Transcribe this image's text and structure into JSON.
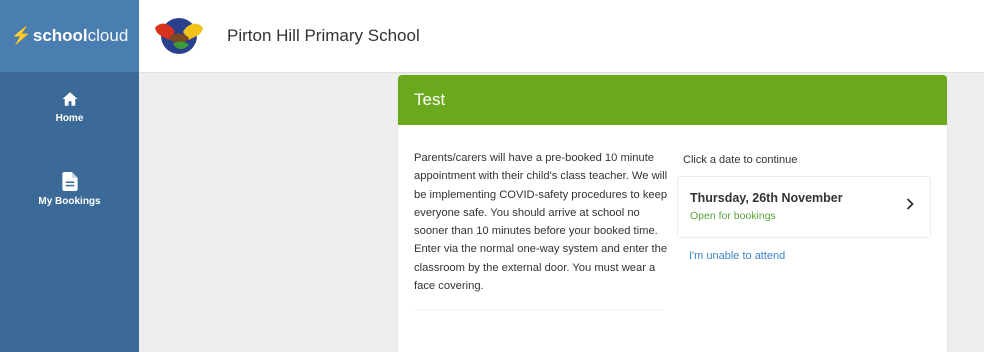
{
  "brand": {
    "bolt": "⚡",
    "name_bold": "school",
    "name_light": "cloud",
    "color": "#4a7db0"
  },
  "header": {
    "school_name": "Pirton Hill Primary School"
  },
  "sidebar": {
    "color": "#3b6a99",
    "items": [
      {
        "label": "Home",
        "icon": "home-icon"
      },
      {
        "label": "My Bookings",
        "icon": "document-icon"
      }
    ]
  },
  "event": {
    "title": "Test",
    "header_color": "#6aa81e",
    "description": "Parents/carers will have a pre-booked 10 minute appointment with their child's class teacher. We will be implementing COVID-safety procedures to keep everyone safe. You should arrive at school no sooner than 10 minutes before your booked time. Enter via the normal one-way system and enter the classroom by the external door. You must wear a face covering.",
    "date_heading": "Click a date to continue",
    "dates": [
      {
        "label": "Thursday, 26th November",
        "status": "Open for bookings",
        "status_color": "#5aa33c"
      }
    ],
    "unable_label": "I'm unable to attend"
  }
}
